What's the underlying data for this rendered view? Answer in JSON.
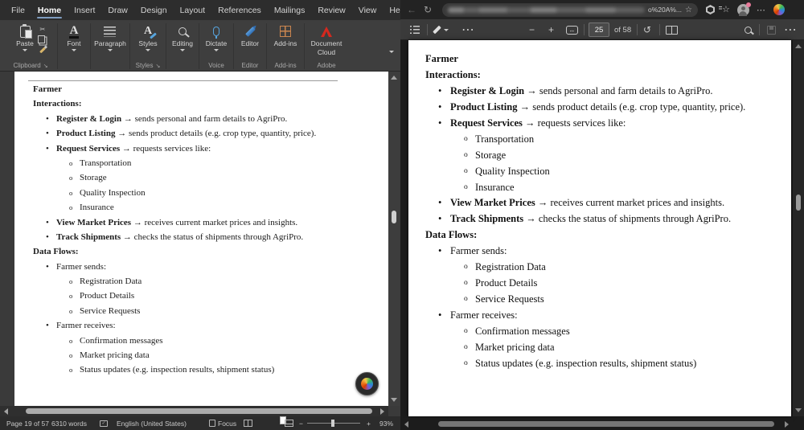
{
  "word": {
    "menu_tabs": [
      {
        "label": "File",
        "cls": ""
      },
      {
        "label": "Home",
        "cls": "active"
      },
      {
        "label": "Insert",
        "cls": ""
      },
      {
        "label": "Draw",
        "cls": ""
      },
      {
        "label": "Design",
        "cls": ""
      },
      {
        "label": "Layout",
        "cls": ""
      },
      {
        "label": "References",
        "cls": ""
      },
      {
        "label": "Mailings",
        "cls": ""
      },
      {
        "label": "Review",
        "cls": ""
      },
      {
        "label": "View",
        "cls": ""
      },
      {
        "label": "Help",
        "cls": ""
      }
    ],
    "ribbon": {
      "paste": "Paste",
      "font": "Font",
      "paragraph": "Paragraph",
      "styles": "Styles",
      "editing": "Editing",
      "dictate": "Dictate",
      "editor": "Editor",
      "addins": "Add-ins",
      "doccloud_line1": "Document",
      "doccloud_line2": "Cloud",
      "grp_clipboard": "Clipboard",
      "grp_styles": "Styles",
      "grp_voice": "Voice",
      "grp_editor": "Editor",
      "grp_addins": "Add-ins",
      "grp_adobe": "Adobe"
    },
    "status": {
      "page": "Page 19 of 57",
      "words": "6310 words",
      "language": "English (United States)",
      "focus": "Focus",
      "zoom": "93%"
    }
  },
  "doc_lines": [
    {
      "type": "h",
      "bold": "Farmer",
      "rest": ""
    },
    {
      "type": "h",
      "bold": "Interactions:",
      "rest": ""
    },
    {
      "type": "b1",
      "bold": "Register & Login",
      "rest": " → sends personal and farm details to AgriPro."
    },
    {
      "type": "b1",
      "bold": "Product Listing",
      "rest": " → sends product details (e.g. crop type, quantity, price)."
    },
    {
      "type": "b1",
      "bold": "Request Services",
      "rest": " → requests services like:"
    },
    {
      "type": "b2",
      "bold": "",
      "rest": "Transportation"
    },
    {
      "type": "b2",
      "bold": "",
      "rest": "Storage"
    },
    {
      "type": "b2",
      "bold": "",
      "rest": "Quality Inspection"
    },
    {
      "type": "b2",
      "bold": "",
      "rest": "Insurance"
    },
    {
      "type": "b1",
      "bold": "View Market Prices",
      "rest": " → receives current market prices and insights."
    },
    {
      "type": "b1",
      "bold": "Track Shipments",
      "rest": " → checks the status of shipments through AgriPro."
    },
    {
      "type": "h",
      "bold": "Data Flows:",
      "rest": ""
    },
    {
      "type": "b1",
      "bold": "",
      "rest": "Farmer sends:"
    },
    {
      "type": "b2",
      "bold": "",
      "rest": "Registration Data"
    },
    {
      "type": "b2",
      "bold": "",
      "rest": "Product Details"
    },
    {
      "type": "b2",
      "bold": "",
      "rest": "Service Requests"
    },
    {
      "type": "b1",
      "bold": "",
      "rest": "Farmer receives:"
    },
    {
      "type": "b2",
      "bold": "",
      "rest": "Confirmation messages"
    },
    {
      "type": "b2",
      "bold": "",
      "rest": "Market pricing data"
    },
    {
      "type": "b2",
      "bold": "",
      "rest": "Status updates (e.g. inspection results, shipment status)"
    }
  ],
  "browser": {
    "url_tail": "o%20A%...",
    "pdf_toolbar": {
      "page": "25",
      "of": "of 58"
    }
  },
  "icons": {
    "back": "←",
    "refresh": "↻",
    "star": "☆",
    "dots": "⋯",
    "favstar": "☆",
    "minus": "−",
    "plus": "+",
    "fitwidth": "↔",
    "rotate": "↺",
    "scissors": "✂",
    "launcher": "↘",
    "proof_check": "✓",
    "scroll_up": "▲",
    "scroll_down": "▼"
  },
  "colors": {
    "share_blue": "#8ab4ec",
    "accent_tab_underline": "#7f9cc0",
    "dictate_blue": "#57a4dd",
    "editor_blue": "#2f6db3",
    "addins_orange": "#c9854f",
    "adobe_red": "#d6281e",
    "page_white": "#ffffff",
    "word_chrome": "#2d2d2d",
    "ribbon_bg": "#3e3e3e",
    "browser_chrome": "#232323",
    "pdf_bg": "#1c1c1c"
  }
}
